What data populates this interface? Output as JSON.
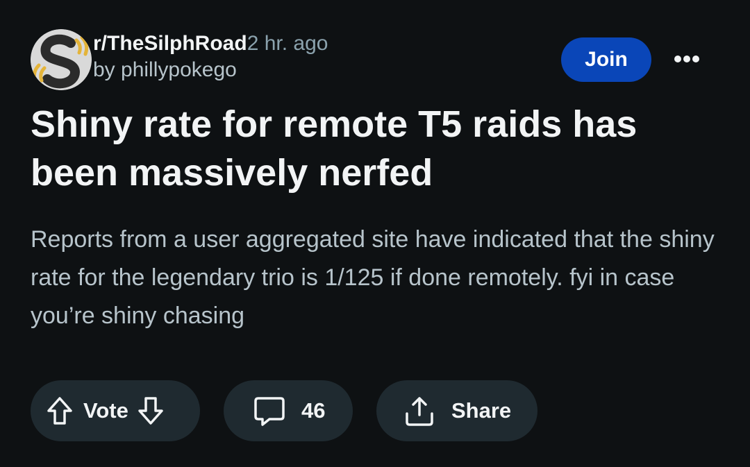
{
  "post": {
    "subreddit": "r/TheSilphRoad",
    "time_ago": "2 hr. ago",
    "author_line": "by phillypokego",
    "title": "Shiny rate for remote T5 raids has been massively nerfed",
    "body": "Reports from a user aggregated site have indicated that the shiny rate for the legendary trio is 1/125 if done remotely. fyi in case you’re shiny chasing"
  },
  "header": {
    "join_label": "Join"
  },
  "actions": {
    "vote_label": "Vote",
    "comment_count": "46",
    "share_label": "Share"
  },
  "colors": {
    "background": "#0e1113",
    "join_button": "#0a46b8",
    "pill_background": "#1f2a30",
    "avatar_gold": "#e4b43a"
  },
  "icons": {
    "avatar": "silph-road-logo",
    "more": "more-options-icon",
    "upvote": "upvote-arrow-icon",
    "downvote": "downvote-arrow-icon",
    "comment": "comment-bubble-icon",
    "share": "share-upload-icon"
  }
}
